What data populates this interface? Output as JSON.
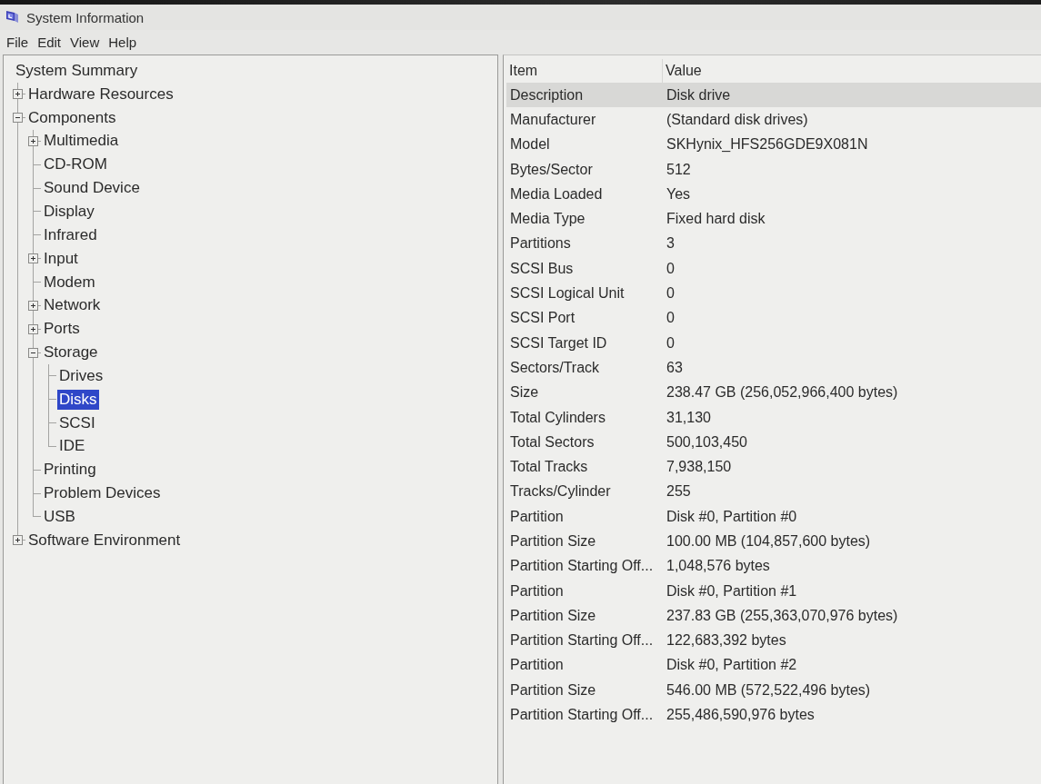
{
  "window": {
    "title": "System Information"
  },
  "menu": [
    "File",
    "Edit",
    "View",
    "Help"
  ],
  "tree": [
    {
      "label": "System Summary",
      "selected": false,
      "children": [
        {
          "label": "Hardware Resources",
          "expanded": false,
          "selected": false
        },
        {
          "label": "Components",
          "expanded": true,
          "selected": false,
          "children": [
            {
              "label": "Multimedia",
              "expanded": false,
              "selected": false
            },
            {
              "label": "CD-ROM",
              "selected": false
            },
            {
              "label": "Sound Device",
              "selected": false
            },
            {
              "label": "Display",
              "selected": false
            },
            {
              "label": "Infrared",
              "selected": false
            },
            {
              "label": "Input",
              "expanded": false,
              "selected": false
            },
            {
              "label": "Modem",
              "selected": false
            },
            {
              "label": "Network",
              "expanded": false,
              "selected": false
            },
            {
              "label": "Ports",
              "expanded": false,
              "selected": false
            },
            {
              "label": "Storage",
              "expanded": true,
              "selected": false,
              "children": [
                {
                  "label": "Drives",
                  "selected": false
                },
                {
                  "label": "Disks",
                  "selected": true
                },
                {
                  "label": "SCSI",
                  "selected": false
                },
                {
                  "label": "IDE",
                  "selected": false
                }
              ]
            },
            {
              "label": "Printing",
              "selected": false
            },
            {
              "label": "Problem Devices",
              "selected": false
            },
            {
              "label": "USB",
              "selected": false
            }
          ]
        },
        {
          "label": "Software Environment",
          "expanded": false,
          "selected": false
        }
      ]
    }
  ],
  "table": {
    "columns": [
      "Item",
      "Value"
    ],
    "rows": [
      {
        "item": "Description",
        "value": "Disk drive",
        "selected": true
      },
      {
        "item": "Manufacturer",
        "value": "(Standard disk drives)",
        "selected": false
      },
      {
        "item": "Model",
        "value": "SKHynix_HFS256GDE9X081N",
        "selected": false
      },
      {
        "item": "Bytes/Sector",
        "value": "512",
        "selected": false
      },
      {
        "item": "Media Loaded",
        "value": "Yes",
        "selected": false
      },
      {
        "item": "Media Type",
        "value": "Fixed hard disk",
        "selected": false
      },
      {
        "item": "Partitions",
        "value": "3",
        "selected": false
      },
      {
        "item": "SCSI Bus",
        "value": "0",
        "selected": false
      },
      {
        "item": "SCSI Logical Unit",
        "value": "0",
        "selected": false
      },
      {
        "item": "SCSI Port",
        "value": "0",
        "selected": false
      },
      {
        "item": "SCSI Target ID",
        "value": "0",
        "selected": false
      },
      {
        "item": "Sectors/Track",
        "value": "63",
        "selected": false
      },
      {
        "item": "Size",
        "value": "238.47 GB (256,052,966,400 bytes)",
        "selected": false
      },
      {
        "item": "Total Cylinders",
        "value": "31,130",
        "selected": false
      },
      {
        "item": "Total Sectors",
        "value": "500,103,450",
        "selected": false
      },
      {
        "item": "Total Tracks",
        "value": "7,938,150",
        "selected": false
      },
      {
        "item": "Tracks/Cylinder",
        "value": "255",
        "selected": false
      },
      {
        "item": "Partition",
        "value": "Disk #0, Partition #0",
        "selected": false
      },
      {
        "item": "Partition Size",
        "value": "100.00 MB (104,857,600 bytes)",
        "selected": false
      },
      {
        "item": "Partition Starting Off...",
        "value": "1,048,576 bytes",
        "selected": false
      },
      {
        "item": "Partition",
        "value": "Disk #0, Partition #1",
        "selected": false
      },
      {
        "item": "Partition Size",
        "value": "237.83 GB (255,363,070,976 bytes)",
        "selected": false
      },
      {
        "item": "Partition Starting Off...",
        "value": "122,683,392 bytes",
        "selected": false
      },
      {
        "item": "Partition",
        "value": "Disk #0, Partition #2",
        "selected": false
      },
      {
        "item": "Partition Size",
        "value": "546.00 MB (572,522,496 bytes)",
        "selected": false
      },
      {
        "item": "Partition Starting Off...",
        "value": "255,486,590,976 bytes",
        "selected": false
      }
    ]
  }
}
